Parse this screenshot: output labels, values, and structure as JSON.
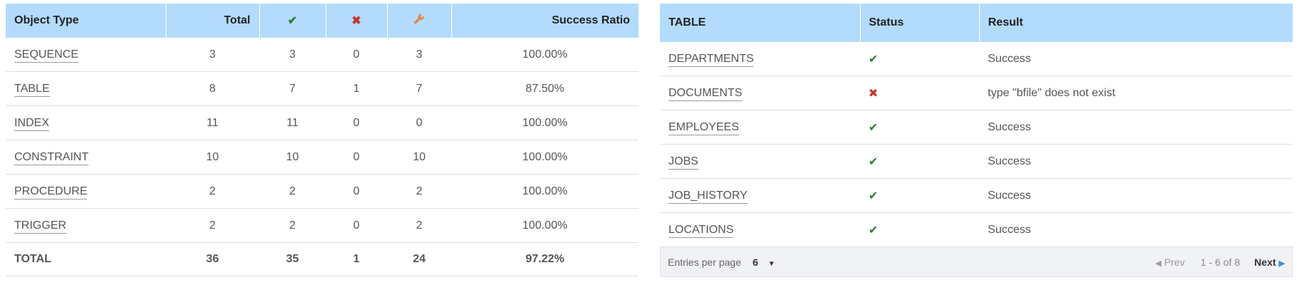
{
  "summary": {
    "headers": {
      "object_type": "Object Type",
      "total": "Total",
      "success_icon": "✔",
      "failure_icon": "✖",
      "fixed_icon": "🔧",
      "success_ratio": "Success Ratio"
    },
    "rows": [
      {
        "name": "SEQUENCE",
        "total": "3",
        "success": "3",
        "failed": "0",
        "fixed": "3",
        "ratio": "100.00%"
      },
      {
        "name": "TABLE",
        "total": "8",
        "success": "7",
        "failed": "1",
        "fixed": "7",
        "ratio": "87.50%"
      },
      {
        "name": "INDEX",
        "total": "11",
        "success": "11",
        "failed": "0",
        "fixed": "0",
        "ratio": "100.00%"
      },
      {
        "name": "CONSTRAINT",
        "total": "10",
        "success": "10",
        "failed": "0",
        "fixed": "10",
        "ratio": "100.00%"
      },
      {
        "name": "PROCEDURE",
        "total": "2",
        "success": "2",
        "failed": "0",
        "fixed": "2",
        "ratio": "100.00%"
      },
      {
        "name": "TRIGGER",
        "total": "2",
        "success": "2",
        "failed": "0",
        "fixed": "2",
        "ratio": "100.00%"
      }
    ],
    "total_row": {
      "name": "TOTAL",
      "total": "36",
      "success": "35",
      "failed": "1",
      "fixed": "24",
      "ratio": "97.22%"
    }
  },
  "detail": {
    "headers": {
      "table": "TABLE",
      "status": "Status",
      "result": "Result"
    },
    "rows": [
      {
        "name": "DEPARTMENTS",
        "status": "success",
        "status_icon": "✔",
        "result": "Success"
      },
      {
        "name": "DOCUMENTS",
        "status": "failure",
        "status_icon": "✖",
        "result": "type \"bfile\" does not exist"
      },
      {
        "name": "EMPLOYEES",
        "status": "success",
        "status_icon": "✔",
        "result": "Success"
      },
      {
        "name": "JOBS",
        "status": "success",
        "status_icon": "✔",
        "result": "Success"
      },
      {
        "name": "JOB_HISTORY",
        "status": "success",
        "status_icon": "✔",
        "result": "Success"
      },
      {
        "name": "LOCATIONS",
        "status": "success",
        "status_icon": "✔",
        "result": "Success"
      }
    ],
    "pager": {
      "entries_label": "Entries per page",
      "per_page_value": "6",
      "dropdown_icon": "▼",
      "prev_icon": "◀",
      "prev_label": "Prev",
      "range_text": "1 - 6 of 8",
      "next_label": "Next",
      "next_icon": "▶"
    }
  },
  "colors": {
    "header_bg": "#b3dbfd",
    "success": "#2e7d32",
    "failure": "#c0392b",
    "fixed": "#e08a4b",
    "next_arrow": "#3c8dde"
  }
}
